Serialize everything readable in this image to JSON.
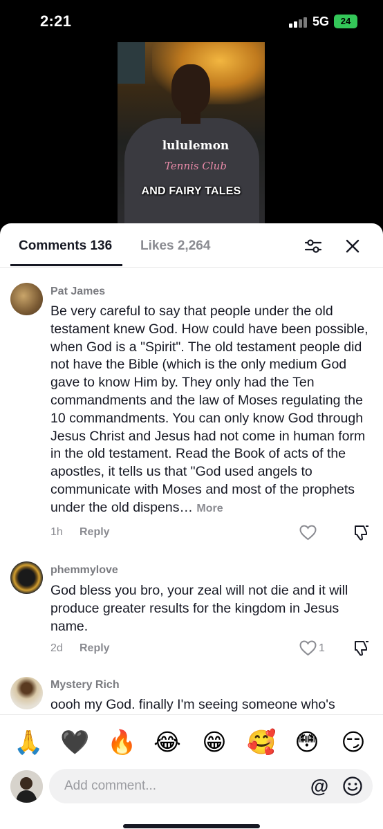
{
  "status_bar": {
    "time": "2:21",
    "network": "5G",
    "battery": "24"
  },
  "video": {
    "caption": "AND FAIRY TALES",
    "shirt_line1": "lululemon",
    "shirt_line2": "Tennis Club"
  },
  "tabs": {
    "comments": "Comments 136",
    "likes": "Likes 2,264"
  },
  "icons": {
    "filter": "sliders-icon",
    "close": "close-icon",
    "like": "heart-icon",
    "dislike": "thumbs-down-icon",
    "mention": "at-sign-icon",
    "emoji": "smile-icon"
  },
  "comments": [
    {
      "user": "Pat James",
      "text": "Be very careful to say that people under the old testament knew God. How could have been possible, when God is a \"Spirit\". The old testament people did not have the Bible (which is the only medium God gave to know Him by. They only had the Ten commandments and the law of Moses regulating the 10 commandments. You can only know God through Jesus Christ and Jesus had not come in human form in the old testament. Read the Book of acts of the apostles, it tells us that \"God used angels to communicate with Moses and most of the prophets under the old dispens…",
      "more": "More",
      "time": "1h",
      "reply": "Reply",
      "likes": ""
    },
    {
      "user": "phemmylove",
      "text": "God bless you bro, your zeal will not die and it will produce greater results for the kingdom in Jesus name.",
      "time": "2d",
      "reply": "Reply",
      "likes": "1"
    },
    {
      "user": "Mystery Rich",
      "text": "oooh my God. finally I'm seeing someone who's"
    }
  ],
  "emoji_bar": [
    "🙏",
    "🖤",
    "🔥",
    "😂",
    "😁",
    "🥰",
    "😳",
    "😏"
  ],
  "composer": {
    "placeholder": "Add comment...",
    "mention": "@"
  },
  "colors": {
    "battery": "#34c759",
    "text_primary": "#161823",
    "text_secondary": "#8a8b91"
  }
}
